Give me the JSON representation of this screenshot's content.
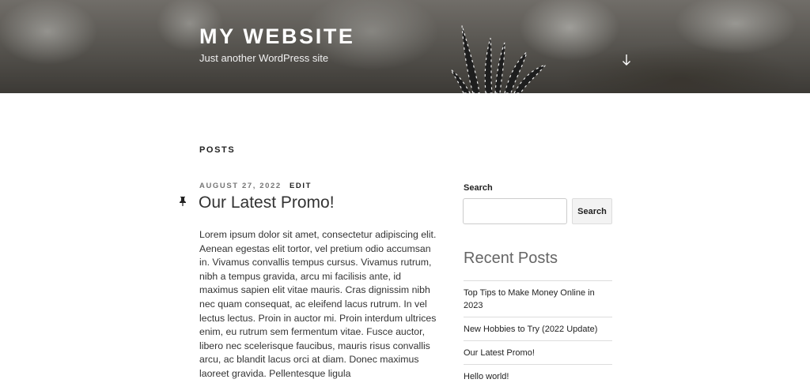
{
  "header": {
    "site_title": "MY WEBSITE",
    "site_description": "Just another WordPress site"
  },
  "main": {
    "page_heading": "POSTS",
    "post": {
      "date": "AUGUST 27, 2022",
      "edit_label": "EDIT",
      "title": "Our Latest Promo!",
      "body": "Lorem ipsum dolor sit amet, consectetur adipiscing elit. Aenean egestas elit tortor, vel pretium odio accumsan in. Vivamus convallis tempus cursus. Vivamus rutrum, nibh a tempus gravida, arcu mi facilisis ante, id maximus sapien elit vitae mauris. Cras dignissim nibh nec quam consequat, ac eleifend lacus rutrum. In vel lectus lectus. Proin in auctor mi. Proin interdum ultrices enim, eu rutrum sem fermentum vitae. Fusce auctor, libero nec scelerisque faucibus, mauris risus convallis arcu, ac blandit lacus orci at diam. Donec maximus laoreet gravida. Pellentesque ligula"
    }
  },
  "sidebar": {
    "search_label": "Search",
    "search_value": "",
    "search_button": "Search",
    "recent_posts_title": "Recent Posts",
    "recent_posts": [
      "Top Tips to Make Money Online in 2023",
      "New Hobbies to Try (2022 Update)",
      "Our Latest Promo!",
      "Hello world!"
    ]
  },
  "icons": {
    "scroll_down": "arrow-down-icon",
    "sticky_post": "thumbtack-icon"
  }
}
